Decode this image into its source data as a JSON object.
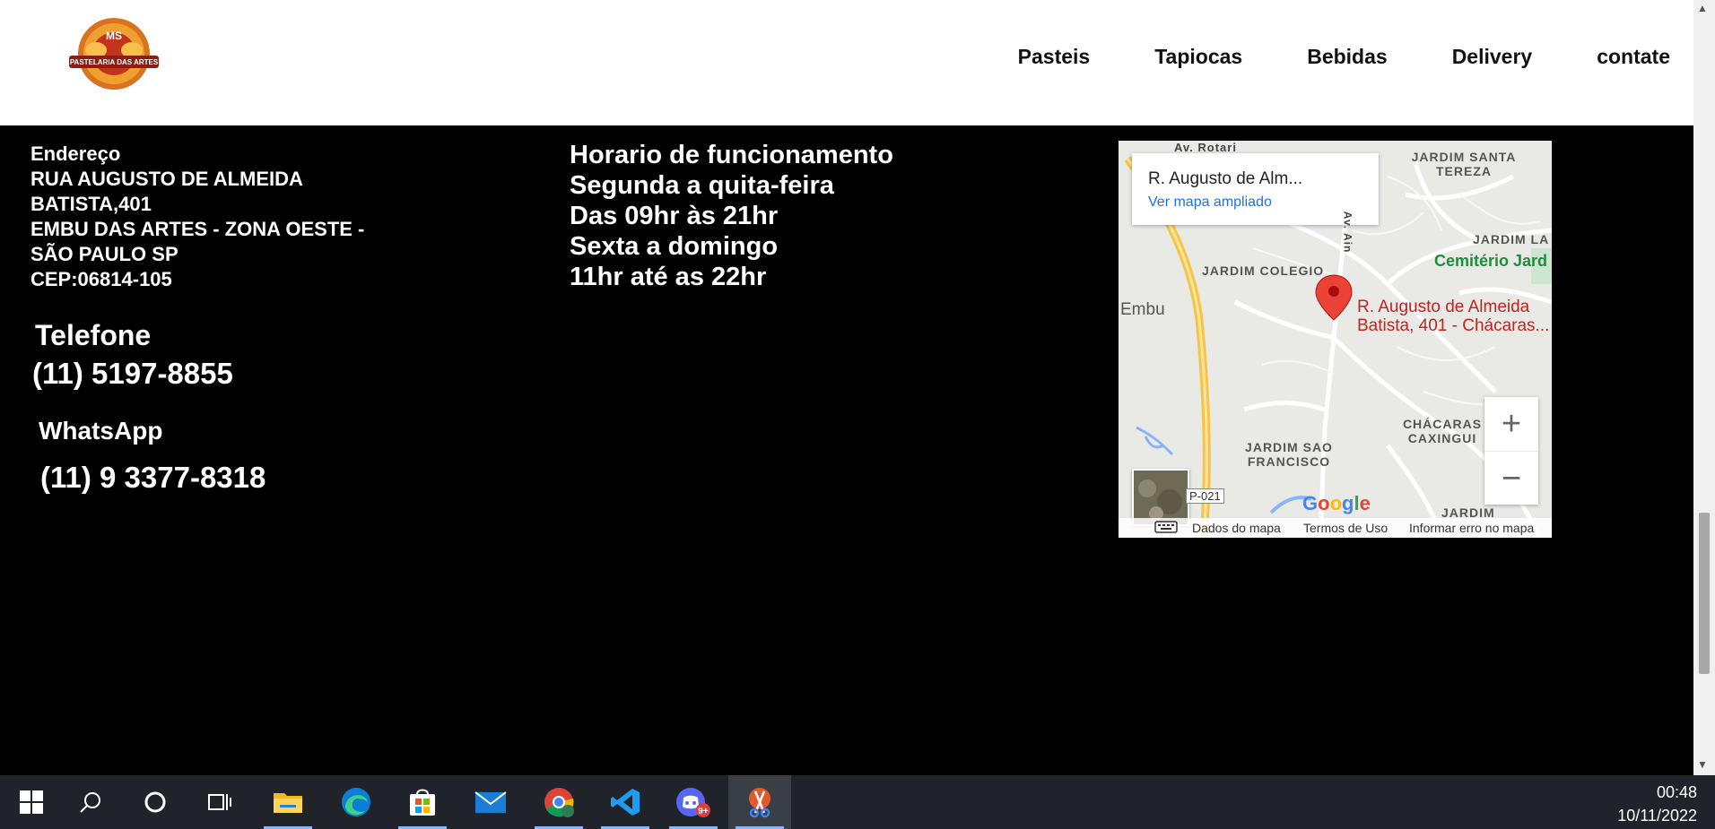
{
  "header": {
    "logo_text_top": "MS",
    "logo_text_banner": "PASTELARIA DAS ARTES",
    "nav": [
      "Pasteis",
      "Tapiocas",
      "Bebidas",
      "Delivery",
      "contate"
    ]
  },
  "address": {
    "lines": [
      "Endereço",
      "RUA AUGUSTO DE ALMEIDA",
      "BATISTA,401",
      "EMBU DAS ARTES - ZONA OESTE -",
      "SÃO PAULO SP",
      "CEP:06814-105"
    ]
  },
  "contact": {
    "telefone_label": "Telefone",
    "telefone": "(11) 5197-8855",
    "whatsapp_label": "WhatsApp",
    "whatsapp": "(11) 9 3377-8318"
  },
  "hours": {
    "lines": [
      "Horario de funcionamento",
      "Segunda a quita-feira",
      "Das 09hr às 21hr",
      "Sexta a domingo",
      "11hr até as 22hr"
    ]
  },
  "map": {
    "card_title": "R. Augusto de Alm...",
    "card_link": "Ver mapa ampliado",
    "labels": {
      "jardim_santa_tereza": "JARDIM SANTA TEREZA",
      "jardim_la": "JARDIM LA",
      "cemiterio": "Cemitério Jard",
      "jardim_colegio": "JARDIM COLEGIO",
      "embu": "Embu",
      "pin_line1": "R. Augusto de Almeida",
      "pin_line2": "Batista, 401 - Chácaras...",
      "chacaras_caxingui": "CHÁCARAS CAXINGUI",
      "jardim_sao_francisco": "JARDIM SAO FRANCISCO",
      "jardim_bottom": "JARDIM",
      "av_rotary": "Av. Rotari",
      "av_ain": "Av. Ain",
      "route": "P-021"
    },
    "google": "Google",
    "footer": {
      "dados": "Dados do mapa",
      "termos": "Termos de Uso",
      "informar": "Informar erro no mapa"
    },
    "zoom_in": "+",
    "zoom_out": "−"
  },
  "taskbar": {
    "items": [
      "windows-start",
      "search",
      "cortana",
      "task-view",
      "file-explorer",
      "edge",
      "microsoft-store",
      "mail",
      "chrome",
      "vscode",
      "discord",
      "snipping-tool"
    ],
    "discord_badge": "9+",
    "time": "00:48",
    "date": "10/11/2022"
  },
  "colors": {
    "accent_link": "#1a73e8",
    "map_pin": "#ea4335",
    "background": "#000000"
  }
}
